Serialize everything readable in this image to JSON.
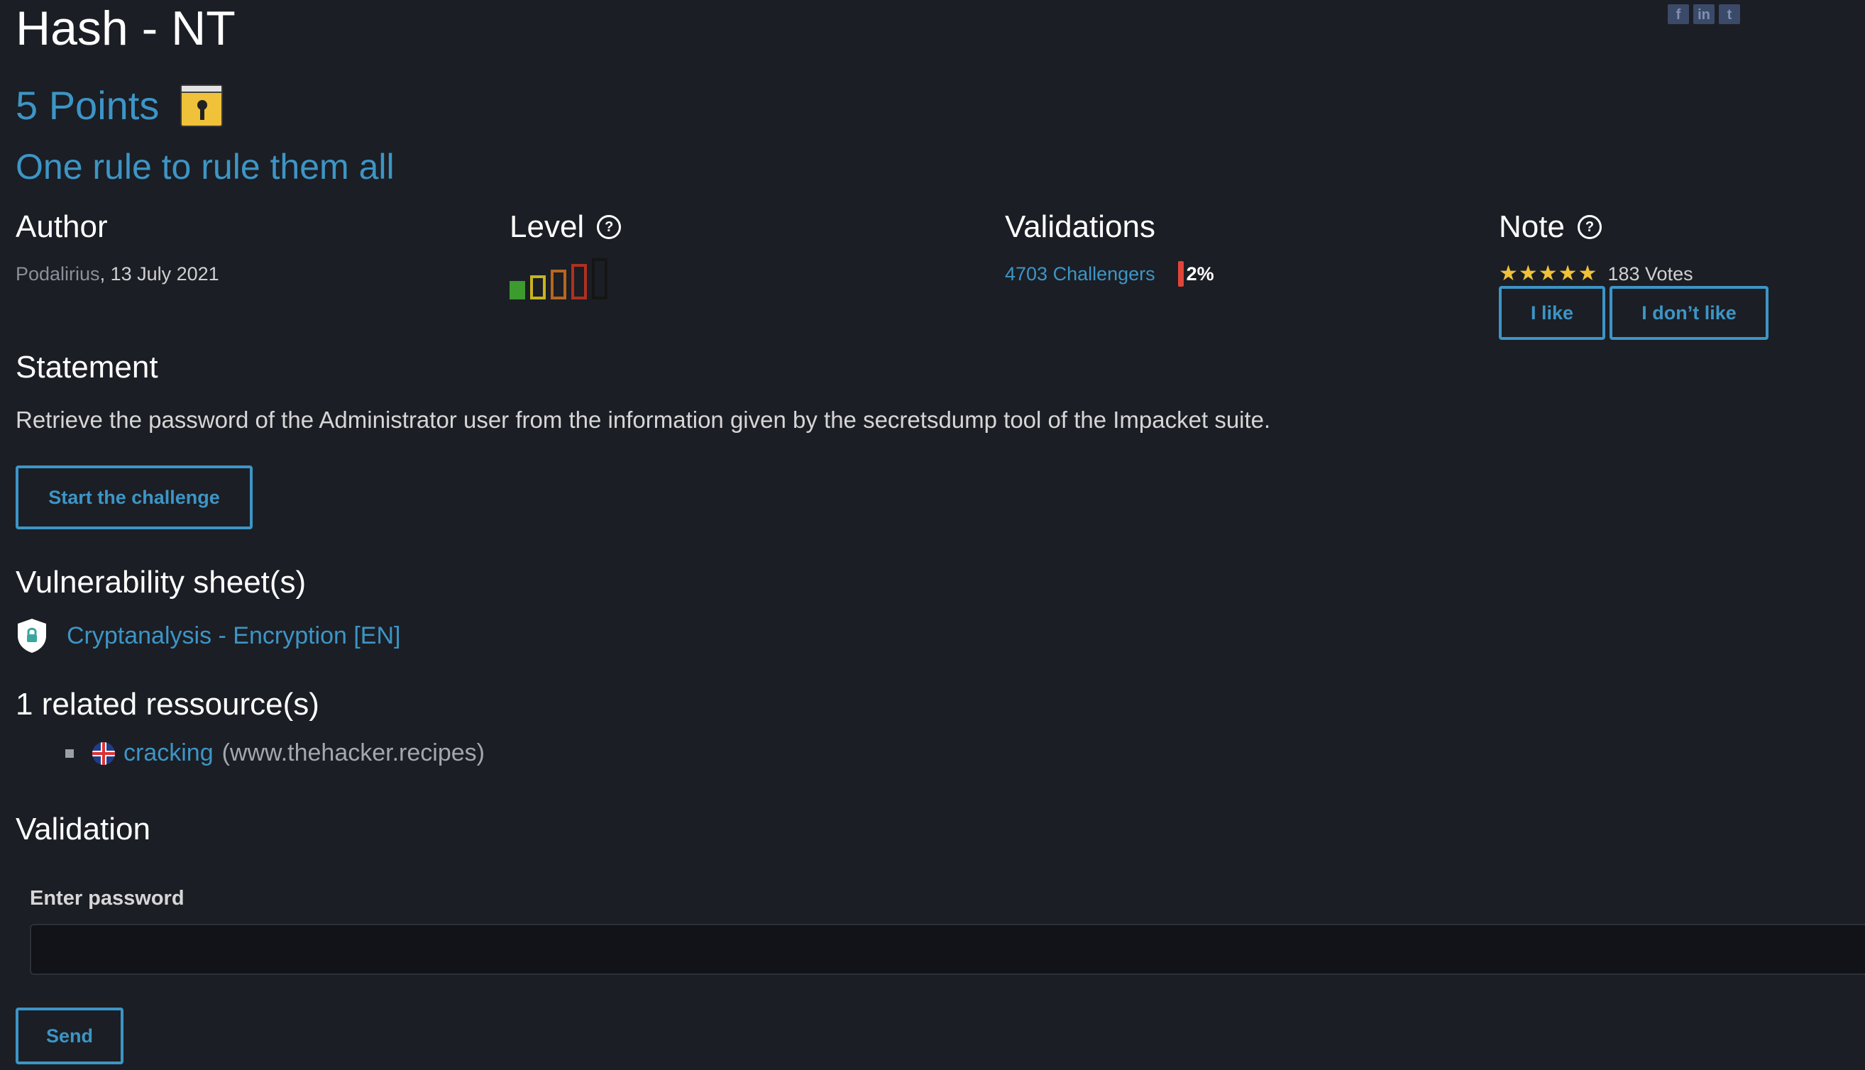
{
  "social": [
    "f",
    "in",
    "t"
  ],
  "challenge": {
    "title": "Hash - NT",
    "points": "5 Points",
    "subtitle": "One rule to rule them all"
  },
  "author": {
    "label": "Author",
    "name": "Podalirius",
    "date": "13 July 2021"
  },
  "level": {
    "label": "Level",
    "value": 1,
    "max": 5,
    "colors": [
      "#3c9a2f",
      "#c8b41f",
      "#b8651f",
      "#b0301f",
      "#151515"
    ]
  },
  "validations": {
    "label": "Validations",
    "challengers": "4703 Challengers",
    "percent": "2%"
  },
  "note": {
    "label": "Note",
    "stars": "★★★★★",
    "votes": "183 Votes",
    "like": "I like",
    "dislike": "I don’t like"
  },
  "statement": {
    "heading": "Statement",
    "text": "Retrieve the password of the Administrator user from the information given by the secretsdump tool of the Impacket suite.",
    "start_button": "Start the challenge"
  },
  "vulnerability": {
    "heading": "Vulnerability sheet(s)",
    "link": "Cryptanalysis - Encryption [EN]"
  },
  "resources": {
    "heading": "1 related ressource(s)",
    "link": "cracking",
    "domain": "(www.thehacker.recipes)"
  },
  "validation": {
    "heading": "Validation",
    "label": "Enter password",
    "placeholder": "",
    "send": "Send"
  },
  "colors": {
    "background": "#1b1e24",
    "accent": "#3d95c6",
    "heading": "#ffffff"
  }
}
